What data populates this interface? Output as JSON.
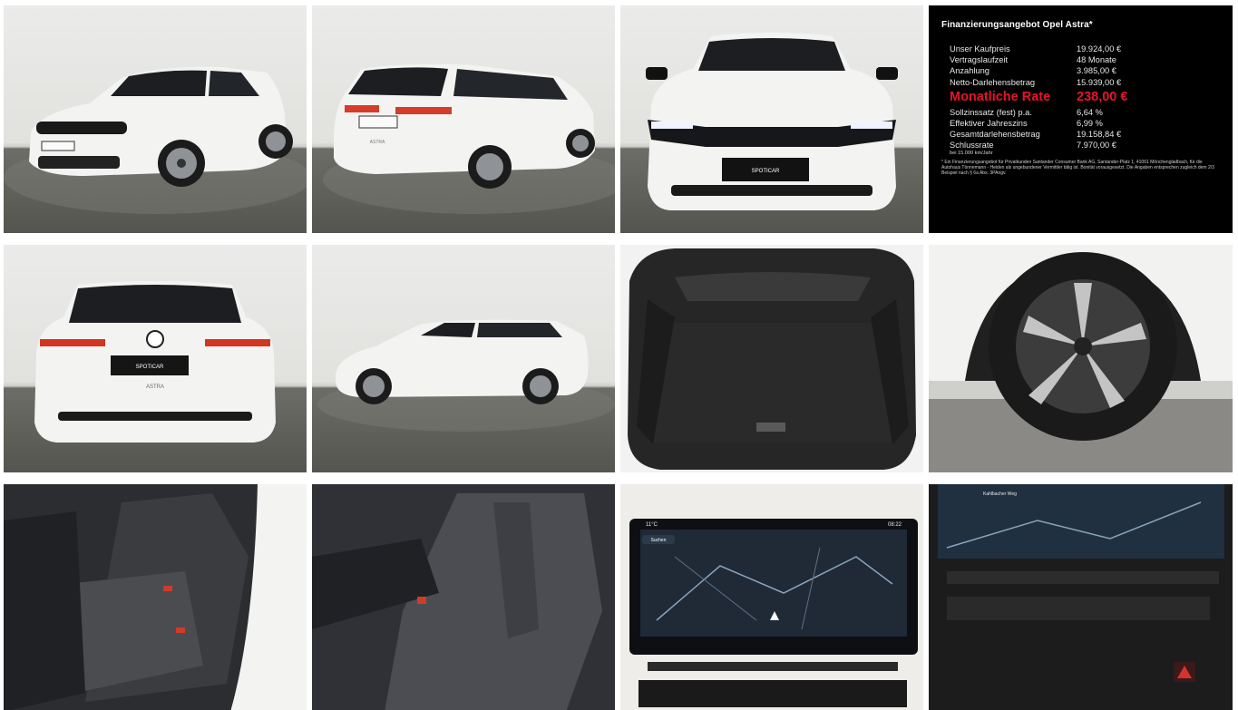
{
  "gallery": {
    "photos": [
      {
        "icon": "car-front-3q-icon"
      },
      {
        "icon": "car-rear-3q-icon",
        "badge": "ASTRA"
      },
      {
        "icon": "car-front-icon",
        "plate": "SPOTICAR"
      },
      {
        "icon": "finance-card"
      },
      {
        "icon": "car-rear-icon",
        "plate": "SPOTICAR",
        "badge": "ASTRA"
      },
      {
        "icon": "car-side-icon"
      },
      {
        "icon": "trunk-icon"
      },
      {
        "icon": "wheel-icon"
      },
      {
        "icon": "rear-seats-icon"
      },
      {
        "icon": "front-seat-icon"
      },
      {
        "icon": "navigation-screen-icon",
        "status_temp": "11°C",
        "status_time": "08:22",
        "search_label": "Suchen"
      },
      {
        "icon": "climate-controls-icon",
        "map_label": "Kahlbacher Weg"
      }
    ]
  },
  "finance": {
    "title": "Finanzierungsangebot Opel Astra*",
    "rows_top": [
      {
        "label": "Unser Kaufpreis",
        "value": "19.924,00 €"
      },
      {
        "label": "Vertragslaufzeit",
        "value": "48 Monate"
      },
      {
        "label": "Anzahlung",
        "value": "3.985,00 €"
      },
      {
        "label": "Netto-Darlehensbetrag",
        "value": "15.939,00 €"
      }
    ],
    "rate_label": "Monatliche Rate",
    "rate_value": "238,00 €",
    "rows_bottom": [
      {
        "label": "Sollzinssatz (fest) p.a.",
        "value": "6,64 %"
      },
      {
        "label": "Effektiver Jahreszins",
        "value": "6,99 %"
      },
      {
        "label": "Gesamtdarlehensbetrag",
        "value": "19.158,84 €"
      },
      {
        "label": "Schlussrate",
        "value": "7.970,00 €"
      }
    ],
    "mileage_note": "bei 15.000 km/Jahr",
    "footnote": "* Ein Finanzierungsangebot für Privatkunden Santander Consumer Bank AG, Santander-Platz 1, 41061 Mönchengladbach, für die Autohaus Tönnemann - Heiden als ungebundener Vermittler tätig ist. Bonität vorausgesetzt. Die Angaben entsprechen zugleich dem 2/3 Beispiel nach § 6a Abs. 3PAngv."
  },
  "colors": {
    "car_white": "#f3f3f2",
    "glass": "#1c1e22",
    "rate_red": "#e4142c",
    "floor": "#5e5e58"
  }
}
